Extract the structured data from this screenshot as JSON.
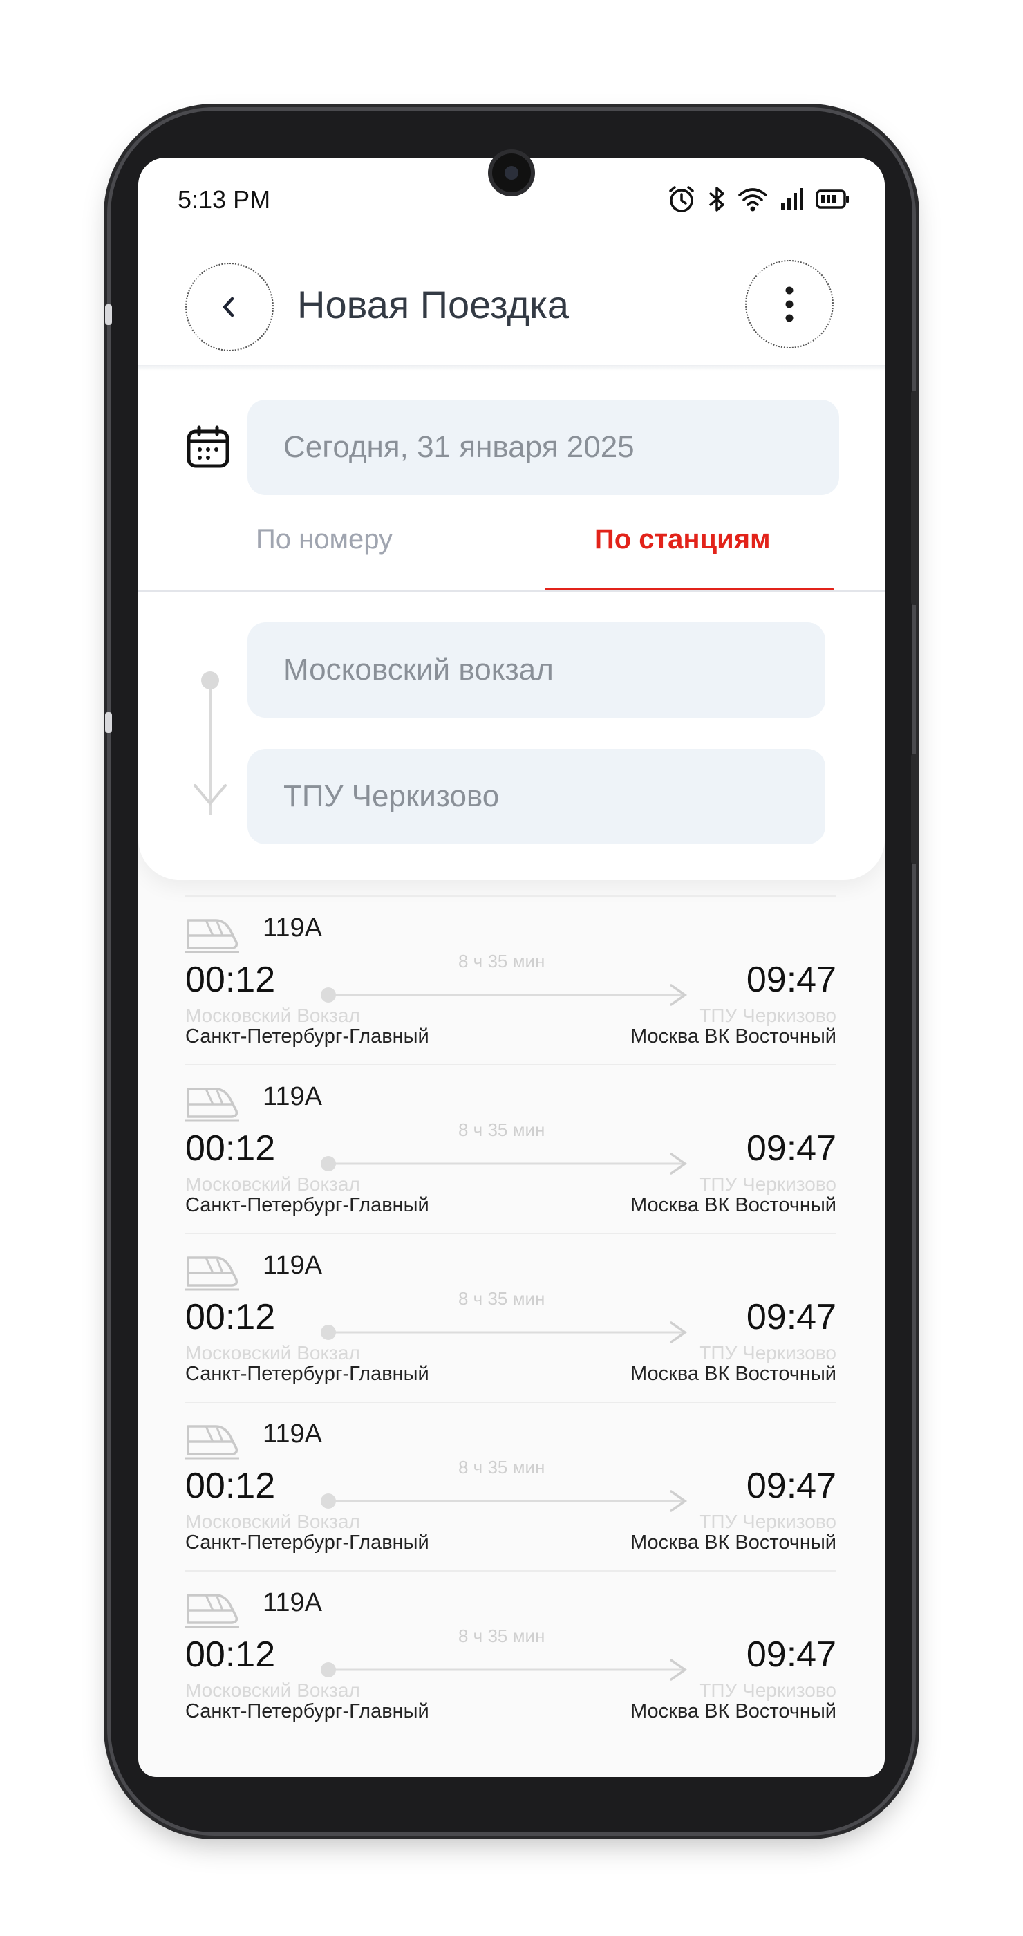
{
  "status_bar": {
    "time": "5:13 PM"
  },
  "header": {
    "title": "Новая Поездка"
  },
  "date_field": {
    "value": "Сегодня, 31 января 2025"
  },
  "tabs": [
    {
      "label": "По номеру",
      "active": false
    },
    {
      "label": "По станциям",
      "active": true
    }
  ],
  "route": {
    "from_placeholder": "Московский вокзал",
    "to_placeholder": "ТПУ Черкизово"
  },
  "colors": {
    "accent": "#e2231a",
    "field_bg": "#eef3f8",
    "title": "#333a44"
  },
  "icons": [
    "back-chevron-icon",
    "more-vertical-icon",
    "calendar-icon",
    "train-icon",
    "alarm-icon",
    "bluetooth-icon",
    "wifi-icon",
    "signal-icon",
    "battery-icon"
  ],
  "trips": [
    {
      "train": "119A",
      "departure": "00:12",
      "arrival": "09:47",
      "duration": "8 ч 35 мин",
      "from_station": "Московский Вокзал",
      "from_city": "Санкт-Петербург-Главный",
      "to_station": "ТПУ Черкизово",
      "to_city": "Москва ВК Восточный"
    },
    {
      "train": "119A",
      "departure": "00:12",
      "arrival": "09:47",
      "duration": "8 ч 35 мин",
      "from_station": "Московский Вокзал",
      "from_city": "Санкт-Петербург-Главный",
      "to_station": "ТПУ Черкизово",
      "to_city": "Москва ВК Восточный"
    },
    {
      "train": "119A",
      "departure": "00:12",
      "arrival": "09:47",
      "duration": "8 ч 35 мин",
      "from_station": "Московский Вокзал",
      "from_city": "Санкт-Петербург-Главный",
      "to_station": "ТПУ Черкизово",
      "to_city": "Москва ВК Восточный"
    },
    {
      "train": "119A",
      "departure": "00:12",
      "arrival": "09:47",
      "duration": "8 ч 35 мин",
      "from_station": "Московский Вокзал",
      "from_city": "Санкт-Петербург-Главный",
      "to_station": "ТПУ Черкизово",
      "to_city": "Москва ВК Восточный"
    },
    {
      "train": "119A",
      "departure": "00:12",
      "arrival": "09:47",
      "duration": "8 ч 35 мин",
      "from_station": "Московский Вокзал",
      "from_city": "Санкт-Петербург-Главный",
      "to_station": "ТПУ Черкизово",
      "to_city": "Москва ВК Восточный"
    }
  ]
}
